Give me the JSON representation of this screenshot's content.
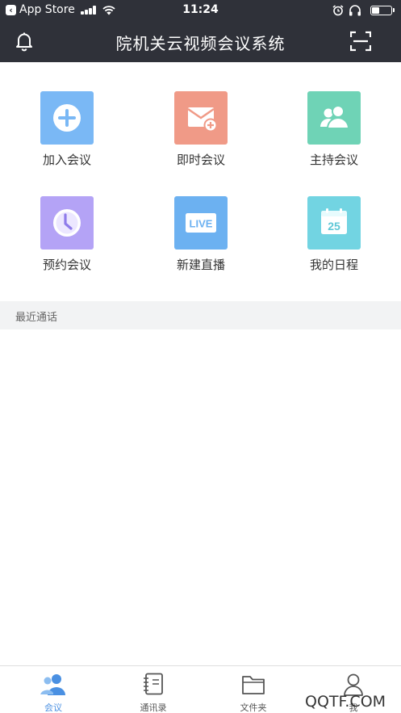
{
  "status_bar": {
    "back_label": "App Store",
    "time": "11:24",
    "battery_level": 0.4
  },
  "nav": {
    "title": "院机关云视频会议系统",
    "left_icon": "bell-icon",
    "right_icon": "scan-icon"
  },
  "actions": [
    {
      "label": "加入会议",
      "icon": "plus-circle-icon",
      "color": "#7ab8f5"
    },
    {
      "label": "即时会议",
      "icon": "envelope-plus-icon",
      "color": "#f09a87"
    },
    {
      "label": "主持会议",
      "icon": "users-icon",
      "color": "#6fd3b6"
    },
    {
      "label": "预约会议",
      "icon": "clock-icon",
      "color": "#b4a3f6"
    },
    {
      "label": "新建直播",
      "icon": "live-icon",
      "color": "#6cb1f1"
    },
    {
      "label": "我的日程",
      "icon": "calendar-icon",
      "color": "#72d4e2",
      "calendar_day": "25"
    }
  ],
  "recent": {
    "title": "最近通话"
  },
  "tabs": [
    {
      "label": "会议",
      "icon": "meeting-icon",
      "active": true
    },
    {
      "label": "通讯录",
      "icon": "contacts-icon",
      "active": false
    },
    {
      "label": "文件夹",
      "icon": "folder-icon",
      "active": false
    },
    {
      "label": "我",
      "icon": "profile-icon",
      "active": false
    }
  ],
  "colors": {
    "header_bg": "#2f3139",
    "tab_active": "#4a90e2",
    "tab_inactive": "#555555"
  },
  "watermark": "QQTF.COM"
}
